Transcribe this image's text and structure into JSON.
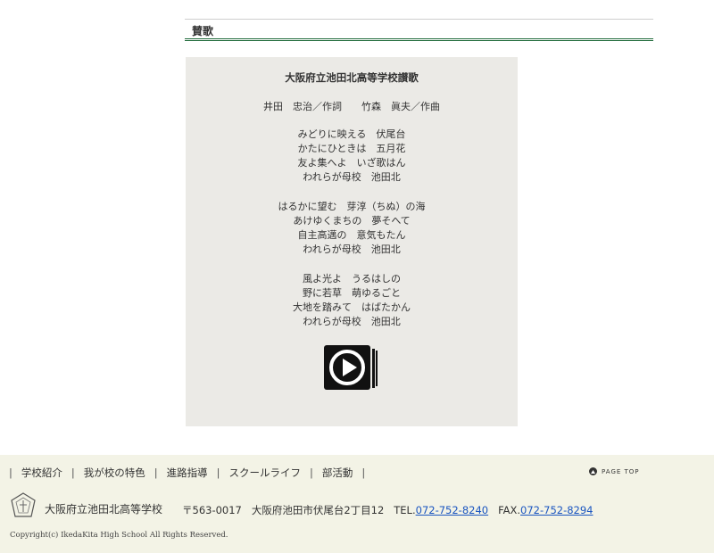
{
  "section": {
    "title": "賛歌"
  },
  "song": {
    "title": "大阪府立池田北高等学校讃歌",
    "credits": "井田　忠治／作詞　　竹森　眞夫／作曲",
    "verses": [
      [
        "みどりに映える　伏尾台",
        "かたにひときは　五月花",
        "友よ集へよ　いざ歌はん",
        "われらが母校　池田北"
      ],
      [
        "はるかに望む　芽淳（ちぬ）の海",
        "あけゆくまちの　夢そへて",
        "自主高邁の　意気もたん",
        "われらが母校　池田北"
      ],
      [
        "風よ光よ　うるはしの",
        "野に若草　萌ゆるごと",
        "大地を踏みて　はばたかん",
        "われらが母校　池田北"
      ]
    ],
    "play_icon": "play-icon"
  },
  "footer": {
    "nav": [
      "学校紹介",
      "我が校の特色",
      "進路指導",
      "スクールライフ",
      "部活動"
    ],
    "page_top": "PAGE TOP",
    "school_name": "大阪府立池田北高等学校",
    "postal": "〒563-0017",
    "address": "大阪府池田市伏尾台2丁目12",
    "tel_label": "TEL.",
    "tel": "072-752-8240",
    "fax_label": "FAX.",
    "fax": "072-752-8294",
    "copyright": "Copyright(c) IkedaKita High School All Rights Reserved."
  },
  "colors": {
    "accent_line": "#1f6a3a",
    "song_bg": "#ebeae6",
    "footer_bg": "#f3f3e6",
    "link": "#1a55c0"
  }
}
